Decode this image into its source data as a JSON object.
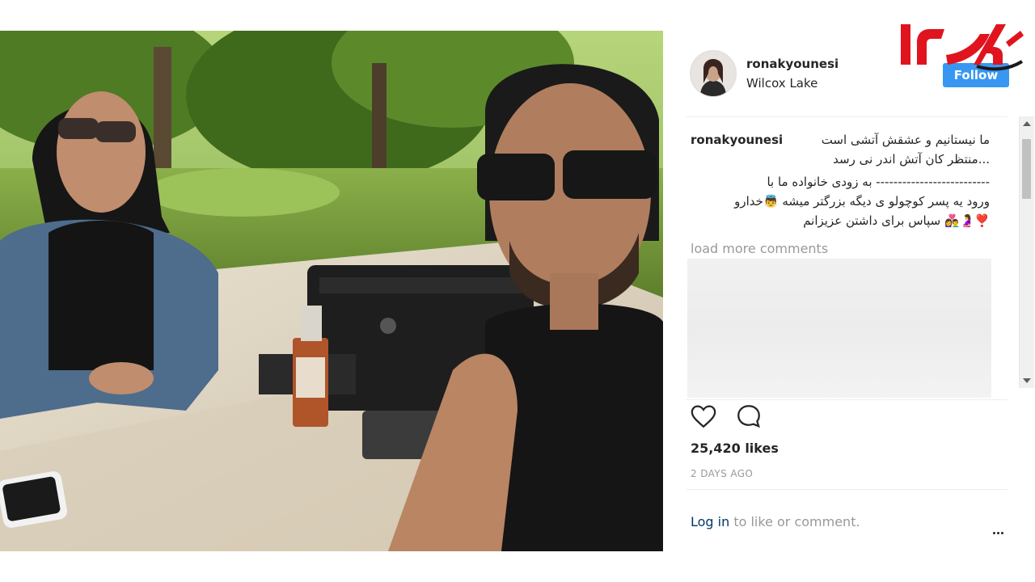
{
  "post": {
    "username": "ronakyounesi",
    "location": "Wilcox Lake",
    "follow_label": "Follow",
    "caption_username": "ronakyounesi",
    "caption_lines": [
      "ما نیستانیم و عشقش آتشی است",
      "...منتظر کان آتش اندر نی رسد",
      "-------------------------- به زودی خانواده ما با",
      "ورود یه پسر کوچولو ی دیگه بزرگتر میشه 👼خدارو",
      "❣️🤰👩‍❤️‍👨 سپاس برای داشتن عزیزانم"
    ],
    "load_more": "load more comments",
    "likes": "25,420 likes",
    "date": "2 DAYS AGO",
    "login_link": "Log in",
    "login_rest": " to like or comment."
  },
  "colors": {
    "follow_button": "#3897f0",
    "login_link": "#003569",
    "logo_red": "#e0141e"
  },
  "icons": [
    "heart-icon",
    "comment-icon",
    "more-options-icon",
    "logo"
  ]
}
